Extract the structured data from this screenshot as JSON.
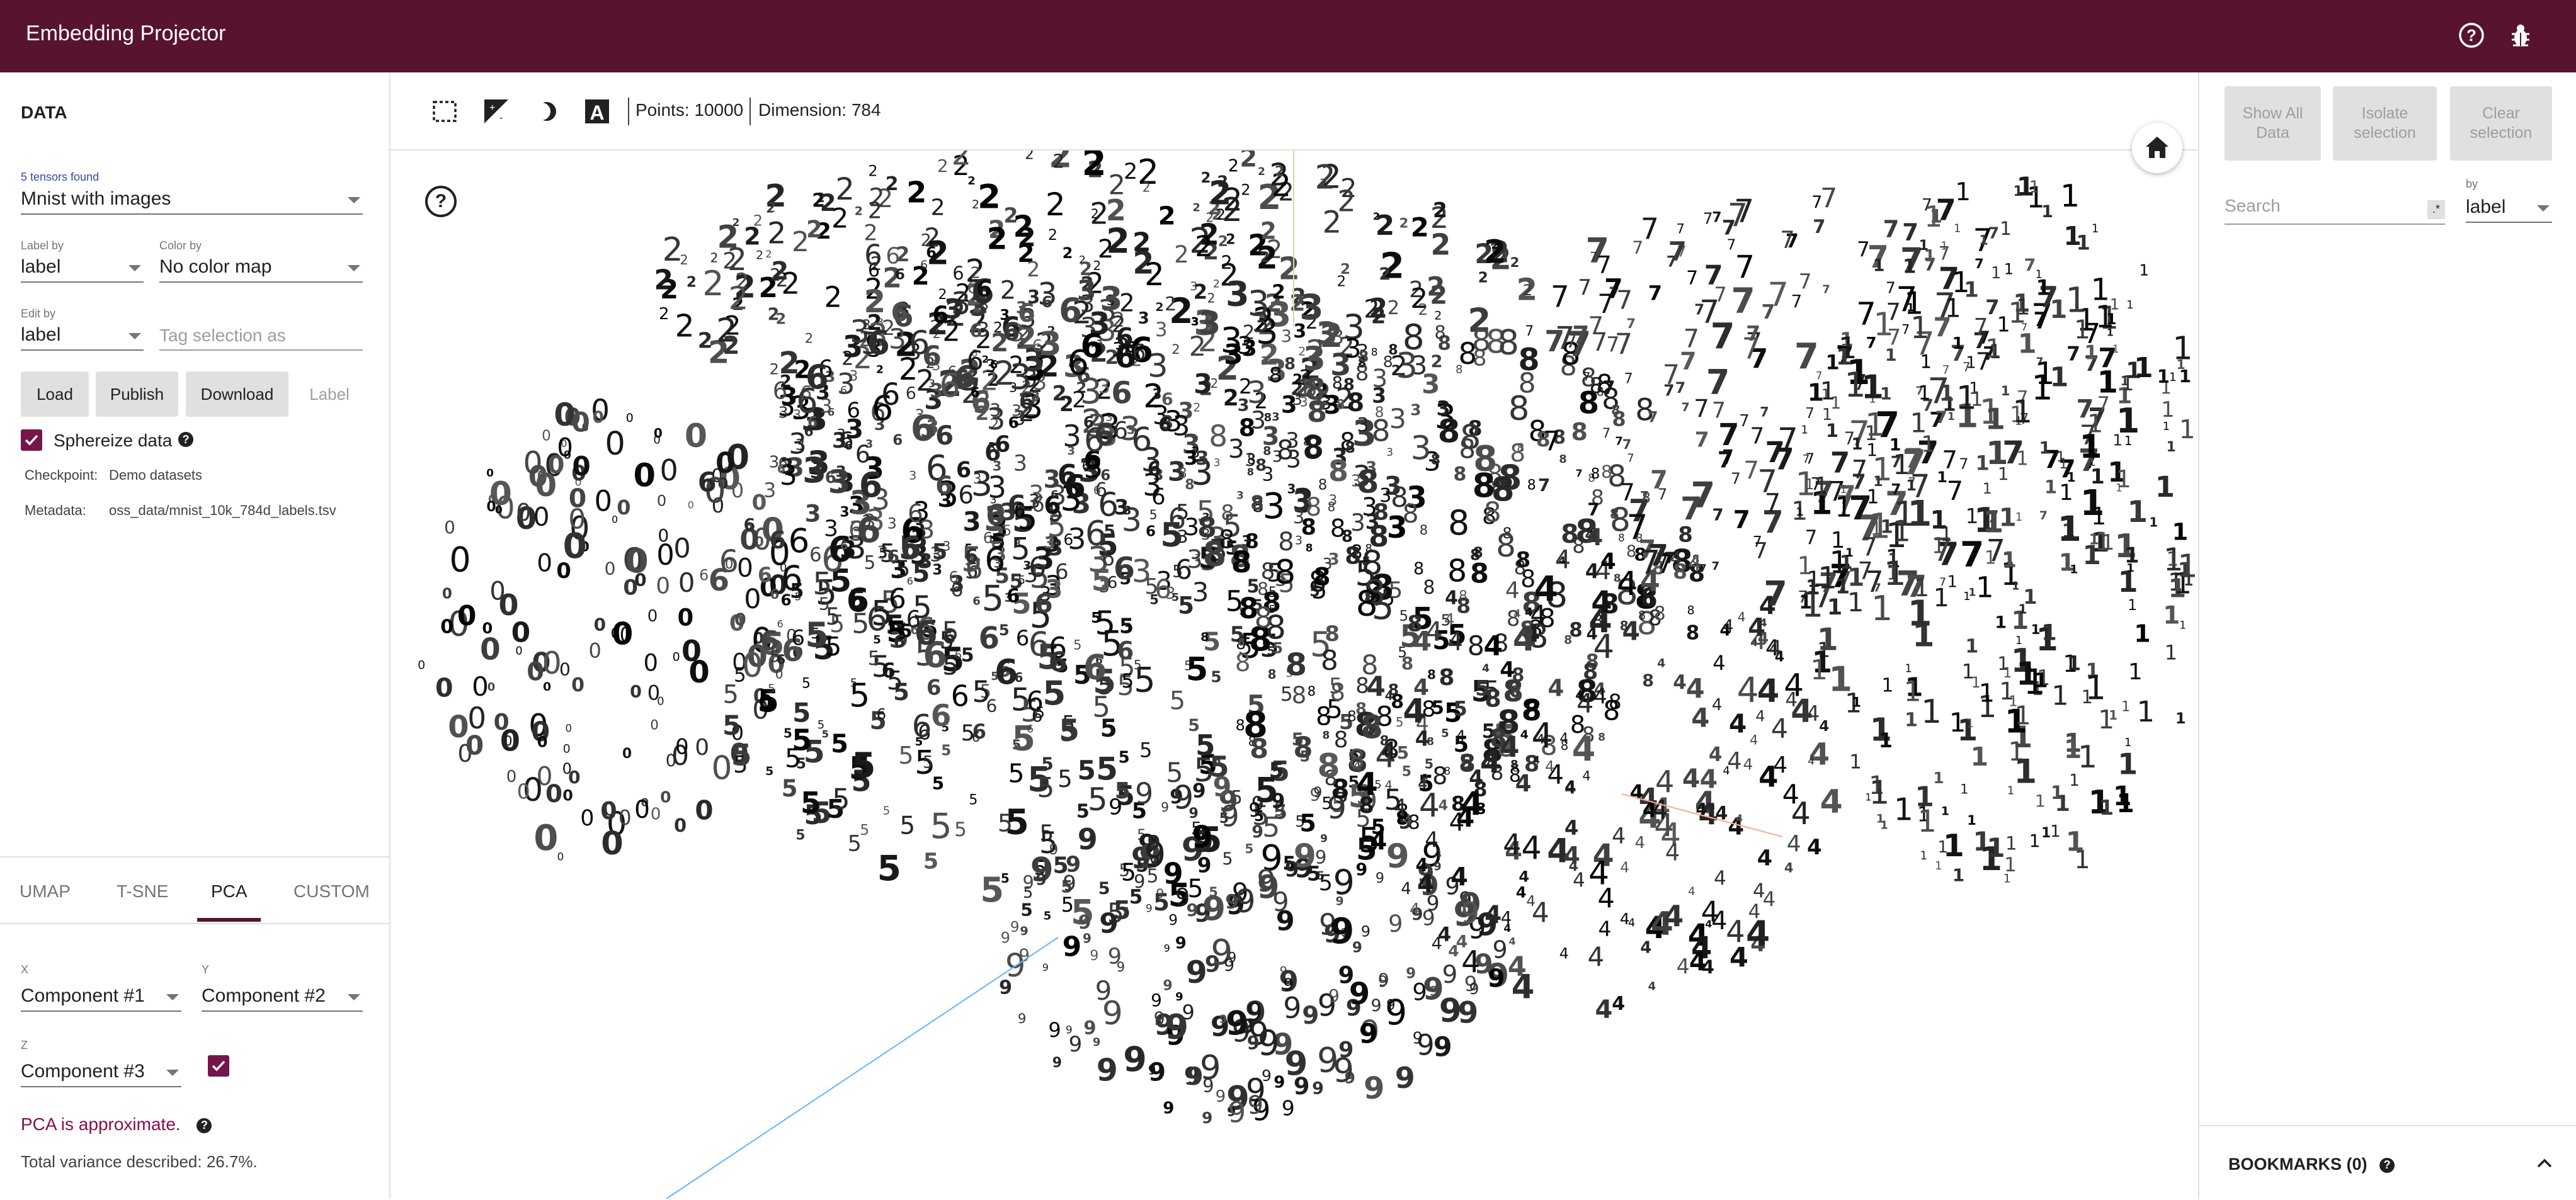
{
  "header": {
    "title": "Embedding Projector"
  },
  "data_panel": {
    "section_title": "DATA",
    "tensors_found": "5 tensors found",
    "tensor_selected": "Mnist with images",
    "label_by_label": "Label by",
    "label_by_value": "label",
    "color_by_label": "Color by",
    "color_by_value": "No color map",
    "edit_by_label": "Edit by",
    "edit_by_value": "label",
    "tag_placeholder": "Tag selection as",
    "buttons": {
      "load": "Load",
      "publish": "Publish",
      "download": "Download",
      "label": "Label"
    },
    "spherize_label": "Sphereize data",
    "spherize_checked": true,
    "checkpoint_label": "Checkpoint:",
    "checkpoint_value": "Demo datasets",
    "metadata_label": "Metadata:",
    "metadata_value": "oss_data/mnist_10k_784d_labels.tsv"
  },
  "projection_tabs": [
    {
      "label": "UMAP",
      "active": false
    },
    {
      "label": "T-SNE",
      "active": false
    },
    {
      "label": "PCA",
      "active": true
    },
    {
      "label": "CUSTOM",
      "active": false
    }
  ],
  "pca": {
    "x_label": "X",
    "x_value": "Component #1",
    "y_label": "Y",
    "y_value": "Component #2",
    "z_label": "Z",
    "z_value": "Component #3",
    "z_enabled": true,
    "warning": "PCA is approximate.",
    "variance": "Total variance described: 26.7%."
  },
  "toolbar": {
    "points": "Points: 10000",
    "dimension": "Dimension: 784"
  },
  "inspector": {
    "show_all": "Show All Data",
    "isolate": "Isolate selection",
    "clear": "Clear selection",
    "search_placeholder": "Search",
    "regex_badge": ".*",
    "by_label": "by",
    "by_value": "label"
  },
  "bookmarks": {
    "title": "BOOKMARKS (0)"
  },
  "colors": {
    "header_bg": "#58132f",
    "accent": "#74164a",
    "warning_text": "#880e4f"
  }
}
